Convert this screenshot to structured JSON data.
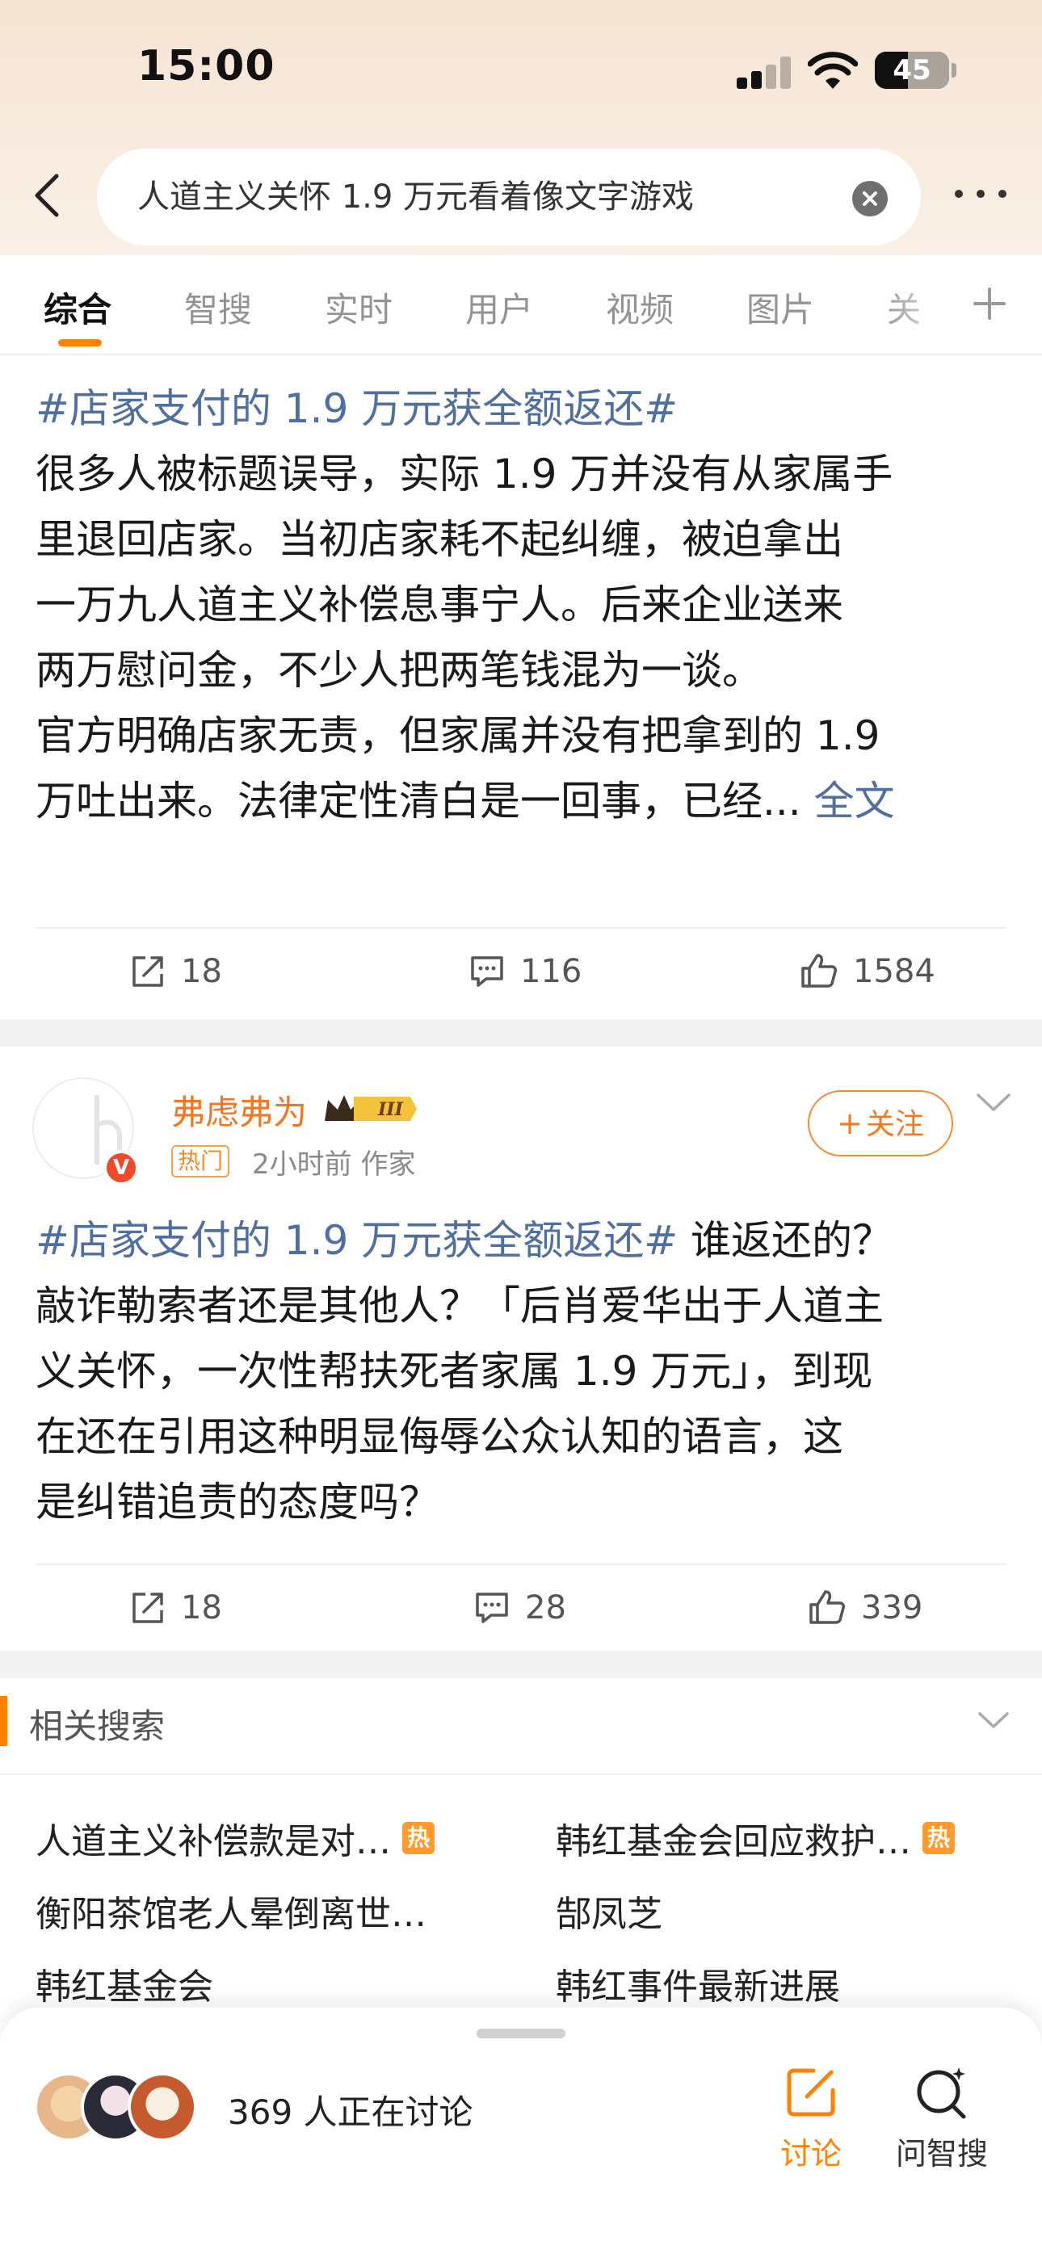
{
  "status": {
    "time": "15:00",
    "battery": "45",
    "battery_fraction": 0.45
  },
  "search": {
    "query": "人道主义关怀 1.9 万元看着像文字游戏"
  },
  "tabs": [
    "综合",
    "智搜",
    "实时",
    "用户",
    "视频",
    "图片",
    "关"
  ],
  "active_tab": 0,
  "post1": {
    "hashtag": "#店家支付的 1.9 万元获全额返还#",
    "lines": [
      "很多人被标题误导，实际 1.9 万并没有从家属手",
      "里退回店家。当初店家耗不起纠缠，被迫拿出",
      "一万九人道主义补偿息事宁人。后来企业送来",
      "两万慰问金，不少人把两笔钱混为一谈。",
      "官方明确店家无责，但家属并没有把拿到的 1.9",
      "万吐出来。法律定性清白是一回事，已经... "
    ],
    "full_link": "全文",
    "reposts": "18",
    "comments": "116",
    "likes": "1584"
  },
  "post2": {
    "username": "弗虑弗为",
    "crown_label": "III",
    "hot_tag": "热门",
    "meta": "2小时前   作家",
    "follow_label": "关注",
    "hashtag": "#店家支付的 1.9 万元获全额返还#",
    "first_line_rest": " 谁返还的？",
    "lines": [
      "敲诈勒索者还是其他人？「后肖爱华出于人道主",
      "义关怀，一次性帮扶死者家属 1.9 万元」，到现",
      "在还在引用这种明显侮辱公众认知的语言，这",
      "是纠错追责的态度吗？"
    ],
    "reposts": "18",
    "comments": "28",
    "likes": "339"
  },
  "related": {
    "title": "相关搜索",
    "items": [
      {
        "text": "人道主义补偿款是对…",
        "hot": "热"
      },
      {
        "text": "韩红基金会回应救护…",
        "hot": "热"
      },
      {
        "text": "衡阳茶馆老人晕倒离世…",
        "hot": ""
      },
      {
        "text": "郜凤芝",
        "hot": ""
      },
      {
        "text": "韩红基金会",
        "hot": ""
      },
      {
        "text": "韩红事件最新进展",
        "hot": ""
      }
    ]
  },
  "bottom": {
    "discussing": "369 人正在讨论",
    "discuss_btn": "讨论",
    "ask_btn": "问智搜"
  },
  "colors": {
    "accent": "#ff8200",
    "link": "#4f6fa0",
    "username": "#f47720"
  }
}
